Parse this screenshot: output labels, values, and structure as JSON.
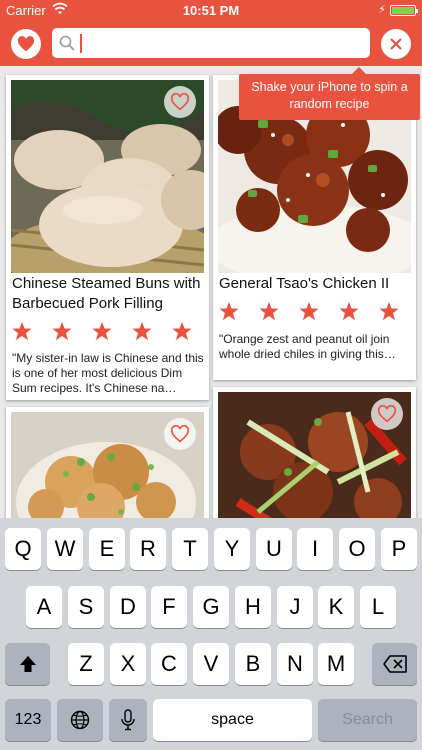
{
  "status_bar": {
    "carrier": "Carrier",
    "time": "10:51 PM"
  },
  "nav": {
    "favorites_icon": "heart-icon",
    "search_icon": "search-icon",
    "clear_icon": "close-icon",
    "search_value": ""
  },
  "tooltip": {
    "text": "Shake your iPhone to spin a random recipe"
  },
  "recipes": [
    {
      "title": "Chinese Steamed Buns with Barbecued Pork Filling",
      "rating": 5,
      "description": "\"My sister-in law is Chinese and this is one of her most delicious Dim Sum recipes. It's Chinese na…"
    },
    {
      "title": "General Tsao's Chicken II",
      "rating": 5,
      "description": "\"Orange zest and peanut oil join whole dried chiles in giving this version of General Tsao's Chicke…"
    },
    {
      "title": "",
      "rating": 0,
      "description": ""
    },
    {
      "title": "",
      "rating": 0,
      "description": ""
    }
  ],
  "keyboard": {
    "row1": [
      "Q",
      "W",
      "E",
      "R",
      "T",
      "Y",
      "U",
      "I",
      "O",
      "P"
    ],
    "row2": [
      "A",
      "S",
      "D",
      "F",
      "G",
      "H",
      "J",
      "K",
      "L"
    ],
    "row3": [
      "Z",
      "X",
      "C",
      "V",
      "B",
      "N",
      "M"
    ],
    "numbers_key": "123",
    "space_key": "space",
    "search_key": "Search"
  },
  "colors": {
    "brand": "#e8523f",
    "star": "#e8523f",
    "background": "#e9e9e9"
  }
}
